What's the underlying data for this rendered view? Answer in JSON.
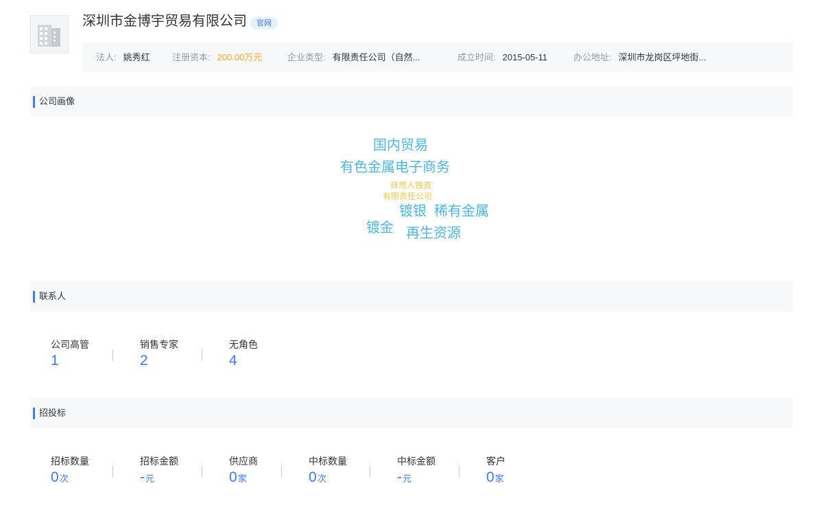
{
  "company": {
    "name": "深圳市金博宇贸易有限公司",
    "official_badge": "官网"
  },
  "info": {
    "legal_person_label": "法人:",
    "legal_person": "姚秀红",
    "capital_label": "注册资本:",
    "capital": "200.00万元",
    "type_label": "企业类型:",
    "type": "有限责任公司（自然...",
    "founded_label": "成立时间:",
    "founded": "2015-05-11",
    "address_label": "办公地址:",
    "address": "深圳市龙岗区坪地街..."
  },
  "profile": {
    "title": "公司画像",
    "words": [
      "国内贸易",
      "有色金属电子商务",
      "自然人独资",
      "有限责任公司",
      "镀银",
      "稀有金属",
      "镀金",
      "再生资源"
    ]
  },
  "contacts": {
    "title": "联系人",
    "stats": [
      {
        "label": "公司高管",
        "value": "1"
      },
      {
        "label": "销售专家",
        "value": "2"
      },
      {
        "label": "无角色",
        "value": "4"
      }
    ]
  },
  "bidding": {
    "title": "招投标",
    "stats": [
      {
        "label": "招标数量",
        "value": "0",
        "unit": "次"
      },
      {
        "label": "招标金额",
        "value": "-",
        "unit": "元"
      },
      {
        "label": "供应商",
        "value": "0",
        "unit": "家"
      },
      {
        "label": "中标数量",
        "value": "0",
        "unit": "次"
      },
      {
        "label": "中标金额",
        "value": "-",
        "unit": "元"
      },
      {
        "label": "客户",
        "value": "0",
        "unit": "家"
      }
    ]
  },
  "colors": {
    "accent_blue": "#3b7bff",
    "cloud_blue": "#4cb8e8",
    "cloud_yellow": "#f2c94c",
    "capital_orange": "#f5a623"
  },
  "icons": {
    "logo": "building-icon"
  }
}
